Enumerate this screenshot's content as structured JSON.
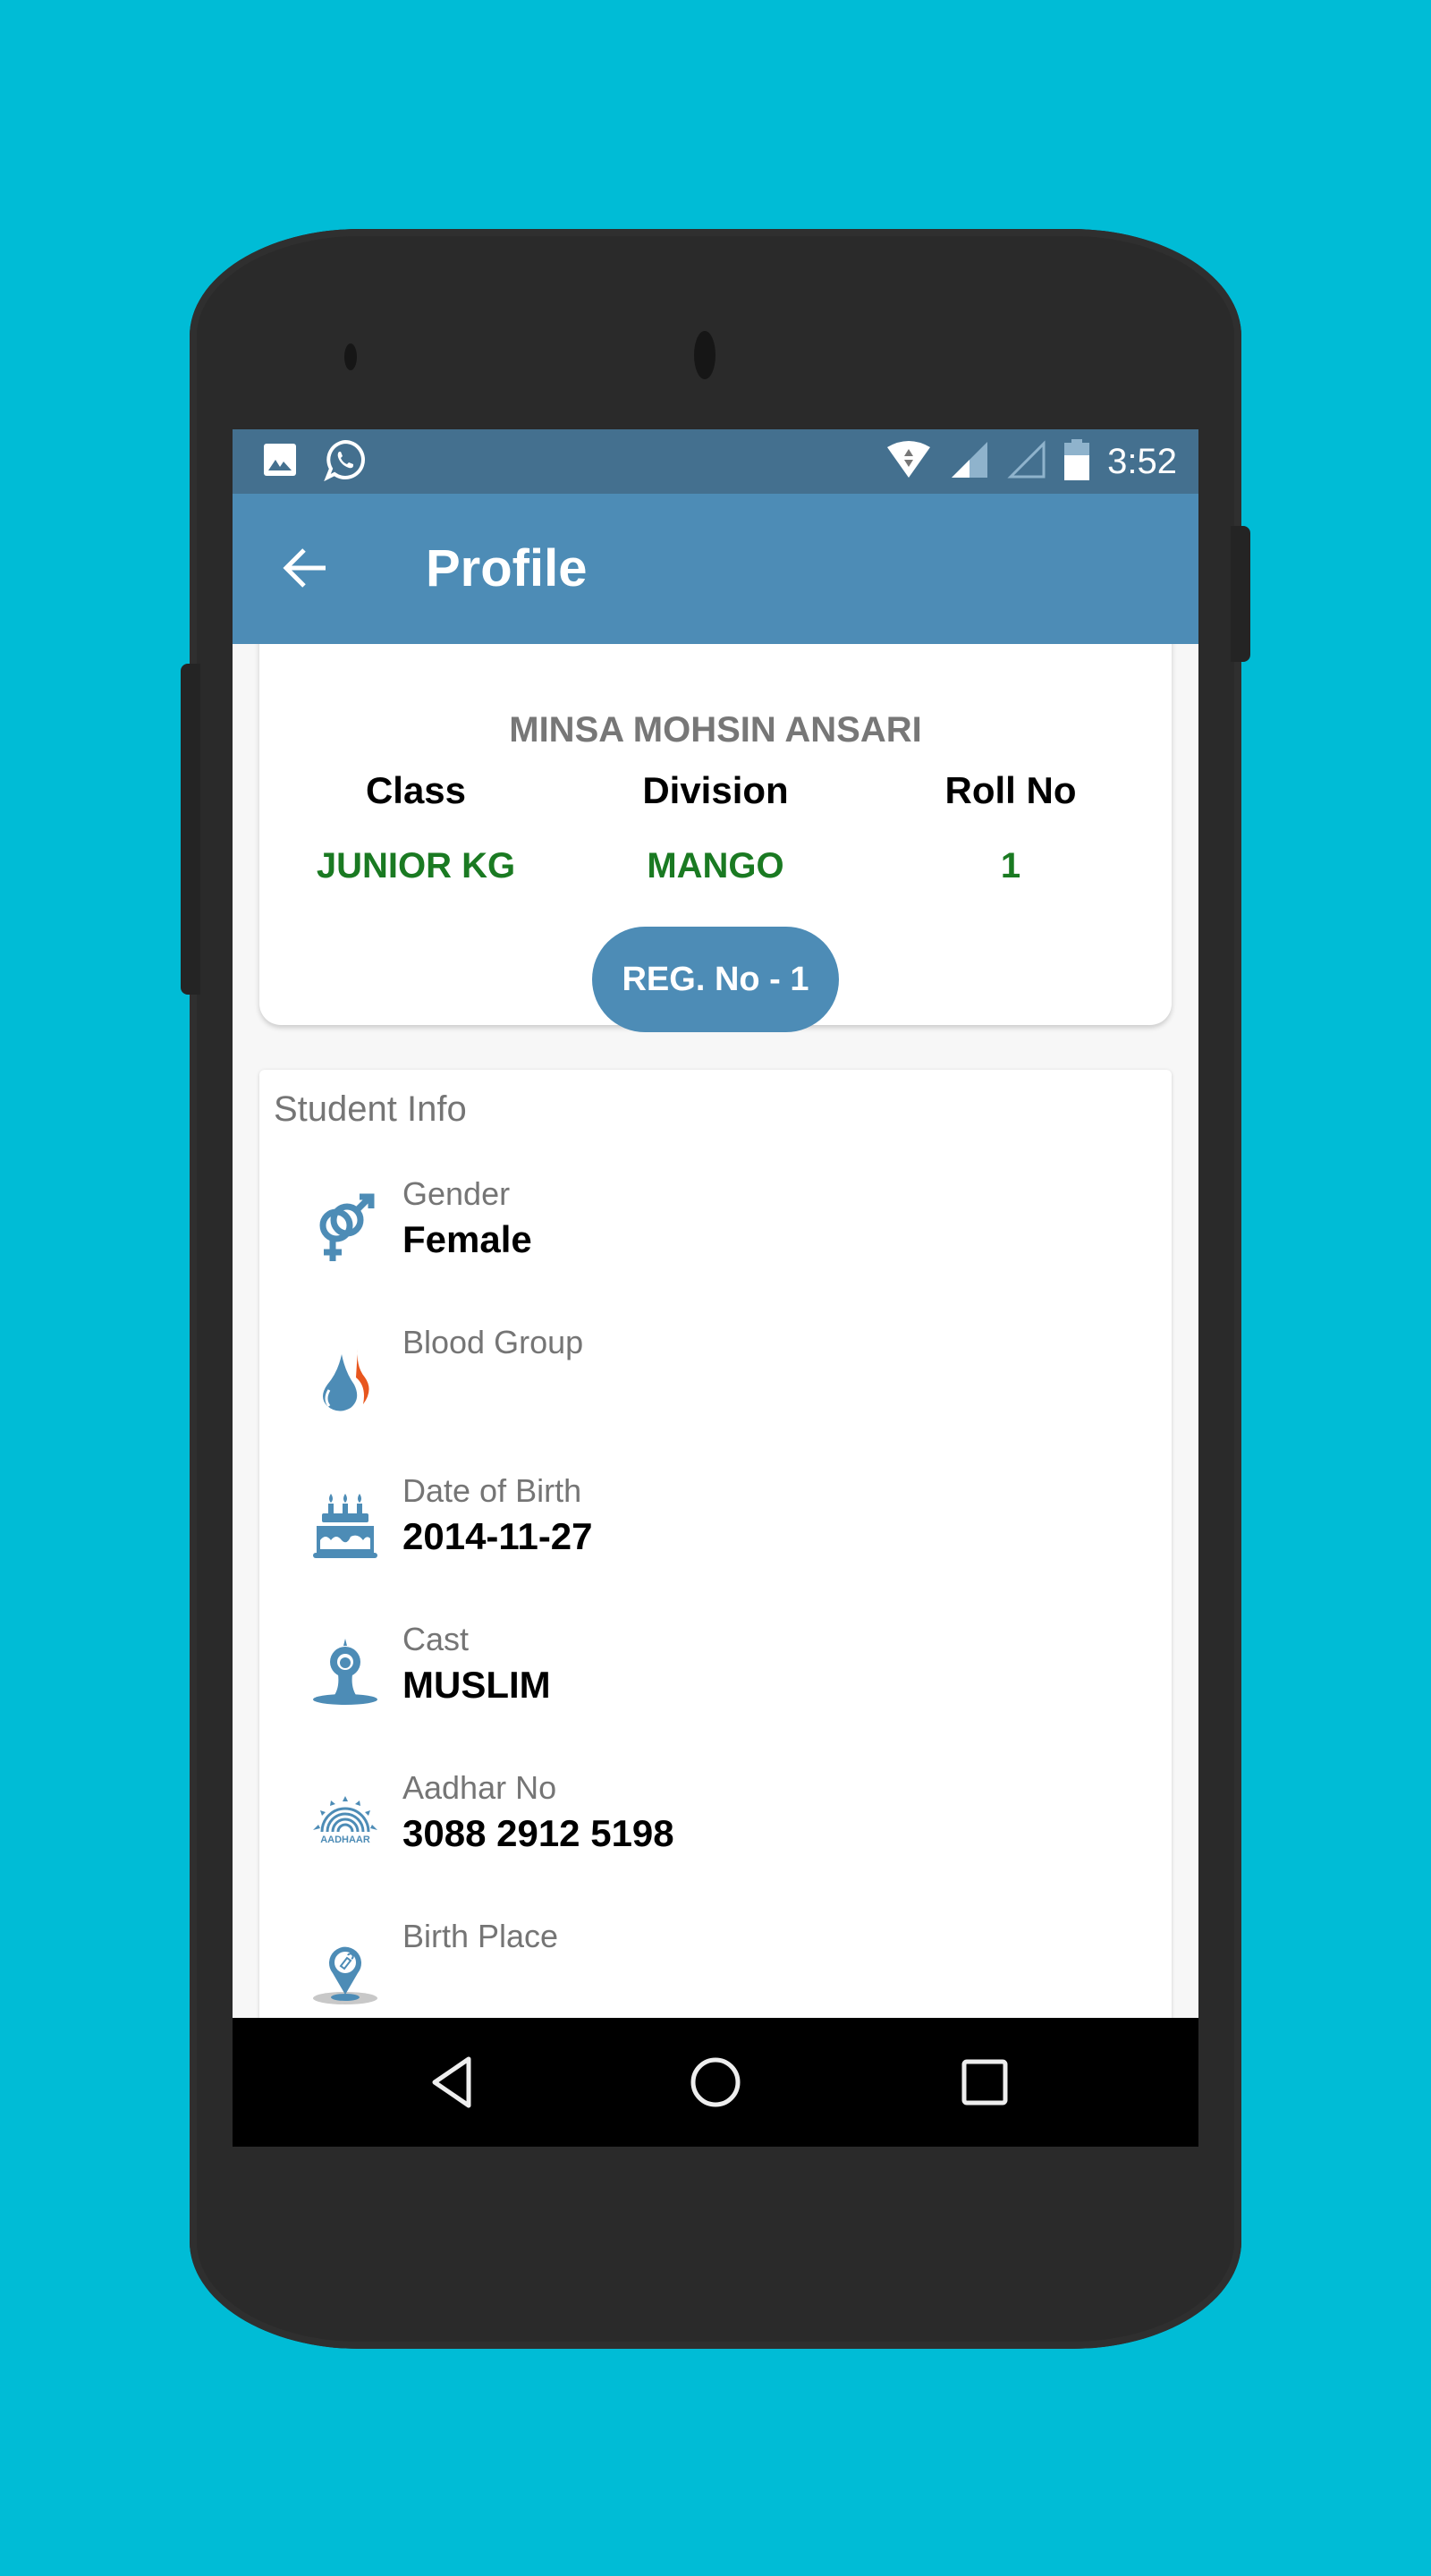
{
  "status_bar": {
    "time": "3:52",
    "left_icons": [
      "image-notification-icon",
      "whatsapp-icon"
    ],
    "right_icons": [
      "wifi-icon",
      "signal-icon",
      "signal-empty-icon",
      "battery-icon"
    ]
  },
  "app_bar": {
    "title": "Profile",
    "back_icon": "arrow-left-icon"
  },
  "header_card": {
    "student_name": "MINSA MOHSIN ANSARI",
    "columns": [
      {
        "label": "Class",
        "value": "JUNIOR KG"
      },
      {
        "label": "Division",
        "value": "MANGO"
      },
      {
        "label": "Roll No",
        "value": "1"
      }
    ],
    "reg_button_label": "REG. No - 1"
  },
  "student_info": {
    "title": "Student Info",
    "items": [
      {
        "icon": "gender-icon",
        "label": "Gender",
        "value": "Female"
      },
      {
        "icon": "blood-drop-icon",
        "label": "Blood Group",
        "value": ""
      },
      {
        "icon": "birthday-cake-icon",
        "label": "Date of Birth",
        "value": "2014-11-27"
      },
      {
        "icon": "meditation-icon",
        "label": "Cast",
        "value": "MUSLIM"
      },
      {
        "icon": "aadhaar-icon",
        "label": "Aadhar No",
        "value": "3088 2912 5198"
      },
      {
        "icon": "location-pin-icon",
        "label": "Birth Place",
        "value": ""
      }
    ],
    "aadhaar_icon_text": "AADHAAR"
  },
  "nav_bar": {
    "buttons": [
      "back-triangle-icon",
      "home-circle-icon",
      "recents-square-icon"
    ]
  },
  "colors": {
    "background": "#00BCD6",
    "status_bar": "#44708F",
    "app_bar": "#4D8CB6",
    "value_green": "#1A7A22",
    "icon_blue": "#4D8CB6",
    "blood_accent": "#E8561E"
  }
}
